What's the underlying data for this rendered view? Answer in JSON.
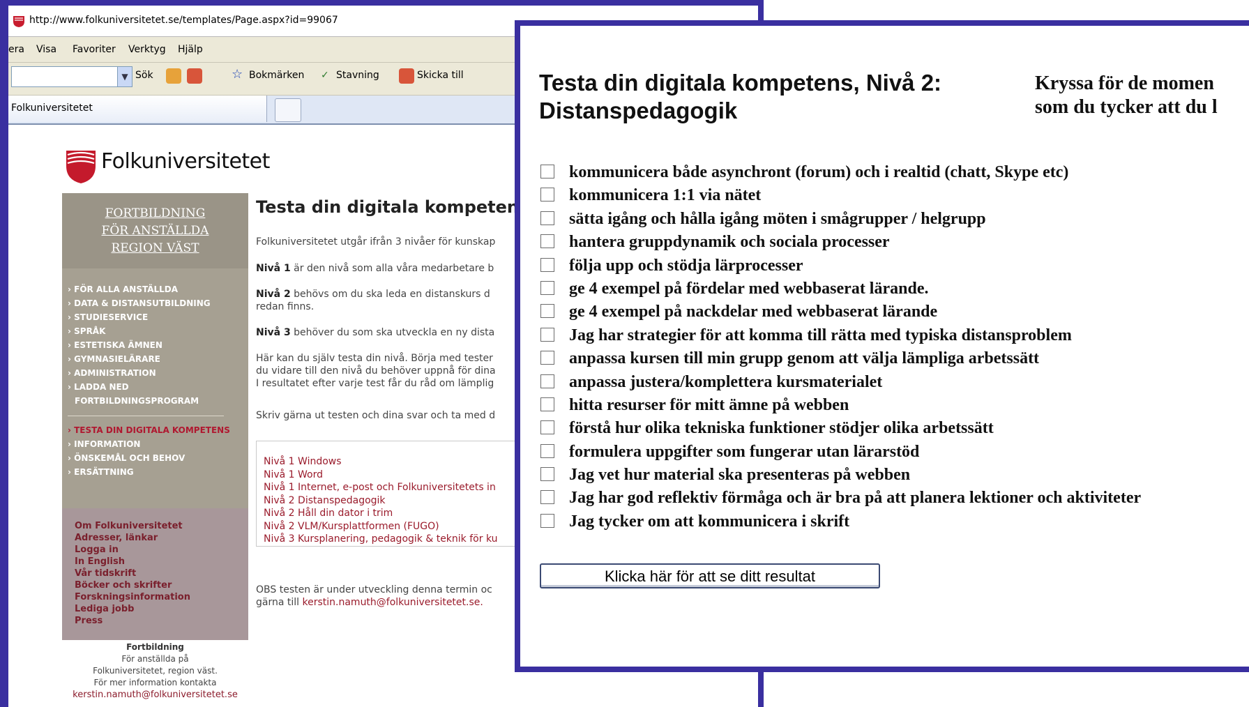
{
  "browser": {
    "url": "http://www.folkuniversitetet.se/templates/Page.aspx?id=99067",
    "menu": [
      "era",
      "Visa",
      "Favoriter",
      "Verktyg",
      "Hjälp"
    ],
    "toolbar": {
      "search_label": "Sök",
      "bookmarks_label": "Bokmärken",
      "spelling_label": "Stavning",
      "send_label": "Skicka till"
    },
    "tab_title": "Folkuniversitetet"
  },
  "site": {
    "logo_text": "Folkuniversitetet",
    "sidebar_heading": [
      "FORTBILDNING",
      "FÖR ANSTÄLLDA",
      "REGION VÄST"
    ],
    "nav_items": [
      "FÖR ALLA ANSTÄLLDA",
      "DATA & DISTANSUTBILDNING",
      "STUDIESERVICE",
      "SPRÅK",
      "ESTETISKA ÄMNEN",
      "GYMNASIELÄRARE",
      "ADMINISTRATION",
      "LADDA NED",
      "FORTBILDNINGSPROGRAM"
    ],
    "nav_items_2": [
      "TESTA DIN DIGITALA KOMPETENS",
      "INFORMATION",
      "ÖNSKEMÅL OCH BEHOV",
      "ERSÄTTNING"
    ],
    "lower_links": [
      "Om Folkuniversitetet",
      "Adresser, länkar",
      "Logga in",
      "In English",
      "Vår tidskrift",
      "Böcker och skrifter",
      "Forskningsinformation",
      "Lediga jobb",
      "Press"
    ],
    "footer": {
      "title": "Fortbildning",
      "line1": "För anställda på",
      "line2": "Folkuniversitetet, region väst.",
      "line3": "För mer information kontakta",
      "email": "kerstin.namuth@folkuniversitetet.se"
    }
  },
  "page": {
    "title": "Testa din digitala kompetens!",
    "intro": "Folkuniversitetet utgår ifrån 3 nivåer för kunskap",
    "level1_bold": "Nivå 1",
    "level1_text": " är den nivå som alla våra medarbetare b",
    "level2_bold": "Nivå 2",
    "level2_text": " behövs om du ska leda en distanskurs d",
    "level2_cont": "redan finns.",
    "level3_bold": "Nivå 3",
    "level3_text": " behöver du som ska utveckla en ny dista",
    "test_p1": "Här kan du själv testa din nivå. Börja med tester",
    "test_p2": "du vidare till den nivå du behöver uppnå för dina",
    "test_p3": "I resultatet efter varje test får du råd om lämplig",
    "print_p": "Skriv gärna ut testen och dina svar och ta med d",
    "test_links": [
      "Nivå 1 Windows",
      "Nivå 1 Word",
      "Nivå 1 Internet, e-post och Folkuniversitetets in",
      "Nivå 2 Distanspedagogik",
      "Nivå 2 Håll din dator i trim",
      "Nivå 2 VLM/Kursplattformen (FUGO)",
      "Nivå 3 Kursplanering, pedagogik & teknik för ku"
    ],
    "obs_line1": "OBS testen är under utveckling denna termin oc",
    "obs_line2_prefix": "gärna till ",
    "obs_email": "kerstin.namuth@folkuniversitetet.se."
  },
  "quiz": {
    "title_line1": "Testa din digitala kompetens, Nivå 2:",
    "title_line2": "Distanspedagogik",
    "intro_line1": "Kryssa för de momen",
    "intro_line2": "som du tycker att du l",
    "items": [
      "kommunicera både asynchront (forum) och i realtid (chatt, Skype etc)",
      "kommunicera 1:1 via nätet",
      "sätta igång och hålla igång möten i smågrupper / helgrupp",
      "hantera gruppdynamik och sociala processer",
      "följa upp och stödja lärprocesser",
      "ge 4 exempel på fördelar med webbaserat lärande.",
      "ge 4 exempel på nackdelar med webbaserat lärande",
      "Jag har strategier för att komma till rätta med typiska distansproblem",
      "anpassa kursen till min grupp genom att välja lämpliga arbetssätt",
      "anpassa justera/komplettera kursmaterialet",
      "hitta resurser för mitt ämne på webben",
      "förstå hur olika tekniska funktioner stödjer olika arbetssätt",
      "formulera uppgifter som fungerar utan lärarstöd",
      "Jag vet hur material ska presenteras på webben",
      "Jag har god reflektiv förmåga och är bra på att planera lektioner och aktiviteter",
      "Jag tycker om att kommunicera i skrift"
    ],
    "button_label": "Klicka här för att se ditt resultat"
  },
  "colors": {
    "frame": "#3a2fa0",
    "brand_red": "#b01830",
    "link": "#9a1b2b"
  }
}
